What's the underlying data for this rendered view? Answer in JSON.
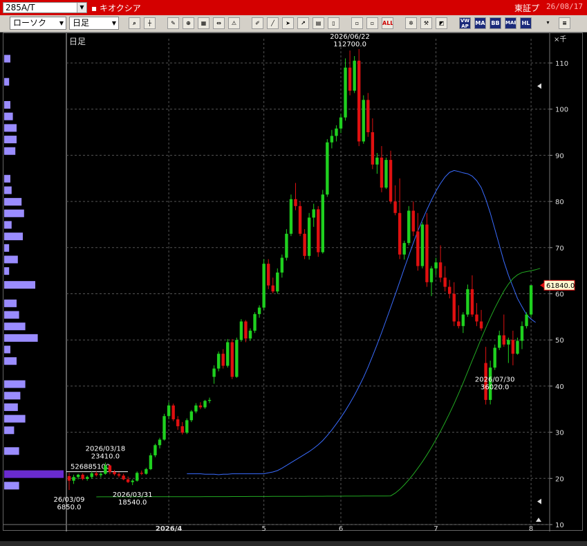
{
  "header": {
    "symbol": "285A/T",
    "stock_name": "▪ キオクシア",
    "exchange": "東証プ",
    "date": "26/08/17"
  },
  "toolbar": {
    "chart_type": "ローソク",
    "period": "日足",
    "buttons": [
      "search",
      "crosshair",
      "draw",
      "zoom",
      "table",
      "news",
      "alert",
      "pen",
      "pointer",
      "cursor",
      "export",
      "memo",
      "trash",
      "box1",
      "box2",
      "all",
      "settings",
      "tools",
      "palette",
      "vwap",
      "MA",
      "BB",
      "MAE",
      "HL"
    ]
  },
  "chart_data": {
    "type": "candlestick",
    "period_label": "日足",
    "unit_label": "×千",
    "ylim": [
      10,
      116
    ],
    "yticks": [
      10,
      20,
      30,
      40,
      50,
      60,
      70,
      80,
      90,
      100,
      110
    ],
    "xticks": [
      {
        "label": "2026/4",
        "i": 22
      },
      {
        "label": "5",
        "i": 43
      },
      {
        "label": "6",
        "i": 60
      },
      {
        "label": "7",
        "i": 81
      },
      {
        "label": "8",
        "i": 102
      }
    ],
    "candles": [
      [
        20.5,
        21.2,
        17.5,
        19.5
      ],
      [
        19.5,
        20.8,
        18.8,
        20.3
      ],
      [
        20.3,
        21.0,
        19.8,
        20.8
      ],
      [
        20.8,
        21.1,
        19.6,
        19.9
      ],
      [
        19.9,
        20.6,
        19.5,
        20.3
      ],
      [
        20.3,
        21.5,
        19.9,
        21.1
      ],
      [
        21.1,
        21.5,
        20.4,
        20.7
      ],
      [
        20.7,
        21.3,
        20.2,
        21.0
      ],
      [
        21.0,
        23.41,
        20.8,
        22.8
      ],
      [
        22.8,
        23.0,
        20.9,
        21.4
      ],
      [
        21.4,
        21.8,
        20.6,
        20.9
      ],
      [
        20.9,
        21.3,
        20.2,
        20.6
      ],
      [
        20.6,
        21.0,
        19.6,
        19.8
      ],
      [
        19.8,
        20.4,
        19.0,
        19.2
      ],
      [
        19.2,
        19.8,
        18.54,
        19.5
      ],
      [
        19.5,
        21.5,
        19.3,
        21.2
      ],
      [
        21.2,
        21.7,
        20.7,
        21.0
      ],
      [
        21.0,
        22.3,
        20.8,
        22.0
      ],
      [
        22.0,
        25.5,
        21.8,
        25.0
      ],
      [
        25.0,
        27.5,
        24.6,
        27.2
      ],
      [
        27.2,
        28.8,
        26.5,
        28.4
      ],
      [
        28.4,
        34.0,
        28.2,
        33.5
      ],
      [
        33.5,
        36.5,
        32.8,
        35.8
      ],
      [
        35.8,
        36.2,
        32.4,
        32.8
      ],
      [
        32.8,
        33.5,
        30.5,
        31.3
      ],
      [
        31.3,
        32.2,
        29.5,
        29.9
      ],
      [
        29.9,
        33.0,
        29.6,
        32.6
      ],
      [
        32.6,
        34.8,
        32.2,
        34.5
      ],
      [
        34.5,
        36.3,
        34.1,
        35.8
      ],
      [
        35.8,
        36.5,
        35.0,
        35.4
      ],
      [
        35.4,
        37.0,
        35.1,
        36.8
      ],
      [
        36.8,
        37.5,
        36.3,
        37.0
      ],
      [
        42.0,
        44.5,
        40.5,
        43.8
      ],
      [
        43.8,
        47.5,
        43.2,
        47.0
      ],
      [
        47.0,
        48.0,
        43.8,
        44.4
      ],
      [
        44.4,
        50.2,
        44.0,
        49.5
      ],
      [
        49.5,
        50.2,
        41.5,
        42.0
      ],
      [
        42.0,
        50.5,
        41.8,
        50.0
      ],
      [
        50.0,
        54.5,
        49.6,
        54.0
      ],
      [
        54.0,
        54.3,
        49.5,
        50.3
      ],
      [
        50.3,
        52.5,
        49.8,
        52.0
      ],
      [
        52.0,
        56.0,
        51.5,
        55.6
      ],
      [
        55.6,
        57.5,
        54.8,
        57.0
      ],
      [
        57.0,
        67.5,
        56.5,
        66.5
      ],
      [
        66.5,
        67.5,
        61.0,
        61.8
      ],
      [
        61.8,
        63.5,
        60.1,
        60.5
      ],
      [
        60.5,
        65.5,
        60.0,
        64.6
      ],
      [
        64.6,
        68.5,
        63.5,
        67.8
      ],
      [
        67.8,
        74.0,
        67.2,
        73.0
      ],
      [
        73.0,
        81.5,
        72.5,
        80.5
      ],
      [
        80.5,
        84.0,
        78.1,
        79.0
      ],
      [
        79.0,
        80.0,
        72.5,
        73.0
      ],
      [
        73.0,
        74.0,
        67.5,
        68.2
      ],
      [
        68.2,
        77.5,
        67.4,
        76.5
      ],
      [
        76.5,
        79.5,
        74.5,
        78.3
      ],
      [
        78.3,
        79.0,
        68.0,
        69.0
      ],
      [
        69.0,
        82.5,
        68.7,
        81.5
      ],
      [
        81.5,
        93.5,
        81.0,
        92.8
      ],
      [
        92.8,
        95.5,
        91.5,
        94.2
      ],
      [
        94.2,
        96.5,
        93.0,
        95.8
      ],
      [
        95.8,
        99.0,
        94.8,
        98.2
      ],
      [
        98.2,
        111.0,
        97.5,
        109.0
      ],
      [
        109.0,
        112.7,
        103.0,
        104.0
      ],
      [
        104.0,
        111.5,
        103.5,
        110.5
      ],
      [
        110.5,
        113.0,
        92.0,
        93.0
      ],
      [
        93.0,
        103.0,
        92.5,
        102.0
      ],
      [
        102.0,
        103.5,
        94.0,
        95.0
      ],
      [
        95.0,
        98.0,
        87.0,
        88.0
      ],
      [
        88.0,
        90.5,
        86.0,
        89.5
      ],
      [
        89.5,
        92.0,
        82.0,
        83.0
      ],
      [
        83.0,
        89.5,
        82.7,
        89.0
      ],
      [
        89.0,
        91.0,
        79.5,
        80.0
      ],
      [
        80.0,
        83.5,
        77.0,
        77.5
      ],
      [
        77.5,
        85.0,
        67.5,
        68.5
      ],
      [
        68.5,
        71.5,
        67.4,
        71.0
      ],
      [
        71.0,
        79.0,
        70.5,
        78.0
      ],
      [
        78.0,
        80.0,
        72.5,
        73.5
      ],
      [
        73.5,
        77.5,
        65.0,
        66.0
      ],
      [
        66.0,
        75.5,
        65.5,
        75.0
      ],
      [
        75.0,
        77.5,
        61.5,
        62.5
      ],
      [
        62.5,
        66.0,
        59.5,
        65.5
      ],
      [
        65.5,
        67.8,
        64.0,
        66.8
      ],
      [
        66.8,
        70.5,
        62.5,
        63.5
      ],
      [
        63.5,
        66.0,
        60.5,
        61.5
      ],
      [
        61.5,
        63.0,
        59.0,
        60.0
      ],
      [
        60.0,
        62.5,
        53.0,
        54.0
      ],
      [
        54.0,
        57.5,
        52.5,
        53.0
      ],
      [
        53.0,
        56.0,
        51.5,
        55.5
      ],
      [
        55.5,
        62.0,
        55.0,
        61.0
      ],
      [
        61.0,
        64.0,
        55.0,
        55.5
      ],
      [
        55.5,
        58.0,
        53.0,
        54.0
      ],
      [
        54.0,
        56.5,
        52.0,
        52.5
      ],
      [
        45.0,
        48.5,
        36.0,
        37.0
      ],
      [
        37.0,
        45.5,
        36.02,
        44.0
      ],
      [
        44.0,
        49.0,
        43.5,
        48.3
      ],
      [
        48.3,
        52.0,
        47.8,
        51.0
      ],
      [
        51.0,
        55.5,
        48.5,
        49.0
      ],
      [
        49.0,
        50.5,
        45.0,
        50.0
      ],
      [
        50.0,
        52.0,
        44.5,
        47.0
      ],
      [
        47.0,
        50.5,
        46.8,
        49.8
      ],
      [
        49.8,
        54.0,
        48.0,
        53.0
      ],
      [
        53.0,
        56.0,
        52.5,
        55.5
      ],
      [
        55.5,
        61.84,
        55.0,
        61.84
      ]
    ],
    "ma_short": [
      21.0,
      21.0,
      21.0,
      21.0,
      20.9,
      20.9,
      20.9,
      20.8,
      20.9,
      20.9,
      21.0,
      21.0,
      21.0,
      21.0,
      21.0,
      21.0,
      21.0,
      21.0,
      21.2,
      21.4,
      21.7,
      22.2,
      22.8,
      23.4,
      24.0,
      24.6,
      25.2,
      25.8,
      26.5,
      27.3,
      28.2,
      29.3,
      30.5,
      31.8,
      33.2,
      34.7,
      36.3,
      38.0,
      39.9,
      41.9,
      44.1,
      46.5,
      49.0,
      51.6,
      54.3,
      57.0,
      59.8,
      62.6,
      65.5,
      68.3,
      71.0,
      73.6,
      76.0,
      78.2,
      80.3,
      82.2,
      83.9,
      85.3,
      86.3,
      86.7,
      86.5,
      86.2,
      86.0,
      85.5,
      84.5,
      83.0,
      80.5,
      77.5,
      74.0,
      70.5,
      67.0,
      64.0,
      61.5,
      59.0,
      57.2,
      55.5,
      54.5,
      53.8
    ],
    "ma_short_start": 26,
    "ma_long": [
      16.2,
      16.8,
      17.6,
      18.6,
      19.7,
      20.9,
      22.2,
      23.6,
      25.1,
      26.7,
      28.4,
      30.2,
      32.1,
      34.1,
      36.2,
      38.4,
      40.7,
      43.1,
      45.5,
      47.9,
      50.3,
      52.6,
      54.8,
      56.9,
      58.8,
      60.6,
      62.1,
      63.3,
      64.1,
      64.6,
      64.8,
      65.0,
      65.2,
      65.5
    ],
    "ma_long_start": 71,
    "annotations": [
      {
        "date": "2026/06/22",
        "value": "112700.0",
        "i": 62
      },
      {
        "date": "2026/07/30",
        "value": "36020.0",
        "i": 94
      },
      {
        "date": "2026/03/18",
        "value": "23410.0",
        "i": 8
      },
      {
        "date": "2026/03/31",
        "value": "18540.0",
        "i": 14
      },
      {
        "date": "26/03/09",
        "value": "6850.0",
        "i": 0
      }
    ],
    "volume_marker": "526885100",
    "last_price_label": "61840.0",
    "volume_profile": [
      [
        111,
        5
      ],
      [
        106,
        4
      ],
      [
        101,
        5
      ],
      [
        98.5,
        7
      ],
      [
        96,
        10
      ],
      [
        93.5,
        10
      ],
      [
        91,
        9
      ],
      [
        85,
        5
      ],
      [
        82.5,
        6
      ],
      [
        80,
        14
      ],
      [
        77.5,
        16
      ],
      [
        75,
        6
      ],
      [
        72.5,
        15
      ],
      [
        70,
        4
      ],
      [
        67.5,
        11
      ],
      [
        65,
        4
      ],
      [
        62,
        25
      ],
      [
        58,
        10
      ],
      [
        55.5,
        12
      ],
      [
        53,
        17
      ],
      [
        50.5,
        27
      ],
      [
        48,
        5
      ],
      [
        45.5,
        10
      ],
      [
        40.5,
        17
      ],
      [
        38,
        13
      ],
      [
        35.5,
        11
      ],
      [
        33,
        17
      ],
      [
        30.5,
        8
      ],
      [
        26,
        12
      ],
      [
        21,
        48
      ],
      [
        18.5,
        12
      ]
    ]
  }
}
